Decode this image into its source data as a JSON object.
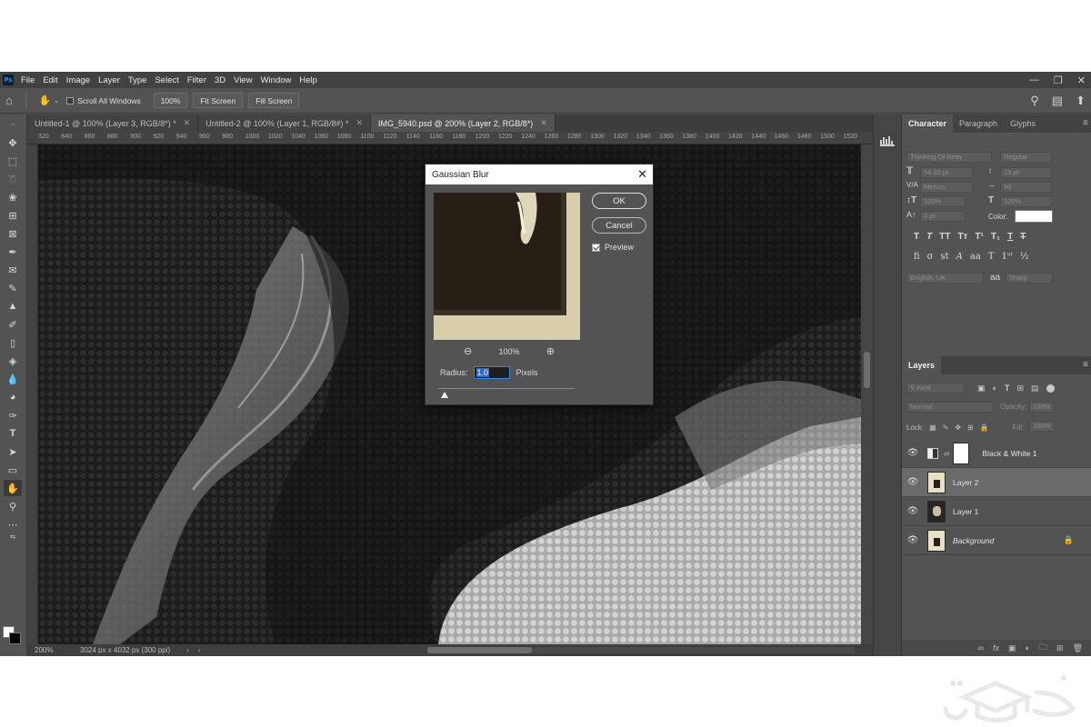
{
  "app": {
    "logo": "Ps"
  },
  "menu": [
    "File",
    "Edit",
    "Image",
    "Layer",
    "Type",
    "Select",
    "Filter",
    "3D",
    "View",
    "Window",
    "Help"
  ],
  "options_bar": {
    "scroll_all_windows": "Scroll All Windows",
    "zoom_value": "100%",
    "fit_screen": "Fit Screen",
    "fill_screen": "Fill Screen"
  },
  "tabs": [
    {
      "label": "Untitled-1 @ 100% (Layer 3, RGB/8*) *",
      "active": false
    },
    {
      "label": "Untitled-2 @ 100% (Layer 1, RGB/8#) *",
      "active": false
    },
    {
      "label": "IMG_5940.psd @ 200% (Layer 2, RGB/8*)",
      "active": true
    }
  ],
  "ruler_ticks": [
    "320",
    "840",
    "860",
    "880",
    "900",
    "920",
    "940",
    "960",
    "980",
    "1000",
    "1020",
    "1040",
    "1060",
    "1080",
    "1100",
    "1120",
    "1140",
    "1160",
    "1180",
    "1200",
    "1220",
    "1240",
    "1260",
    "1280",
    "1300",
    "1320",
    "1340",
    "1360",
    "1380",
    "1400",
    "1420",
    "1440",
    "1460",
    "1480",
    "1500",
    "1520"
  ],
  "status": {
    "zoom": "200%",
    "doc_info": "3024 px x 4032 px (300 ppi)"
  },
  "dialog": {
    "title": "Gaussian Blur",
    "ok": "OK",
    "cancel": "Cancel",
    "preview_label": "Preview",
    "preview_checked": true,
    "zoom": "100%",
    "radius_label": "Radius:",
    "radius_value": "1.0",
    "radius_unit": "Pixels",
    "slider_position": 0.02
  },
  "character_panel": {
    "tabs": [
      "Character",
      "Paragraph",
      "Glyphs"
    ],
    "font_family": "Thinking Of Betty",
    "font_style": "Regular",
    "font_size": "54.92 pt",
    "leading": "13 pt",
    "kerning": "Metrics",
    "tracking": "50",
    "vertical_scale": "100%",
    "horizontal_scale": "100%",
    "baseline_shift": "0 pt",
    "color_label": "Color:",
    "color_value": "#ffffff",
    "language": "English: UK",
    "antialias": "Sharp",
    "aa_glyph": "aa"
  },
  "layers_panel": {
    "title": "Layers",
    "kind_label": "Kind",
    "blend_mode": "Normal",
    "opacity_label": "Opacity:",
    "opacity_value": "100%",
    "lock_label": "Lock:",
    "fill_label": "Fill:",
    "fill_value": "100%",
    "layers": [
      {
        "name": "Black & White 1",
        "type": "adjustment",
        "selected": false,
        "locked": false
      },
      {
        "name": "Layer 2",
        "type": "pixel",
        "selected": true,
        "locked": false
      },
      {
        "name": "Layer 1",
        "type": "pixel",
        "selected": false,
        "locked": false
      },
      {
        "name": "Background",
        "type": "background",
        "selected": false,
        "locked": true
      }
    ]
  },
  "colors": {
    "panel_bg": "#535353",
    "menubar_bg": "#424242",
    "accent_blue": "#2d6bd4",
    "foreground_swatch": "#ffffff",
    "background_swatch": "#000000"
  }
}
